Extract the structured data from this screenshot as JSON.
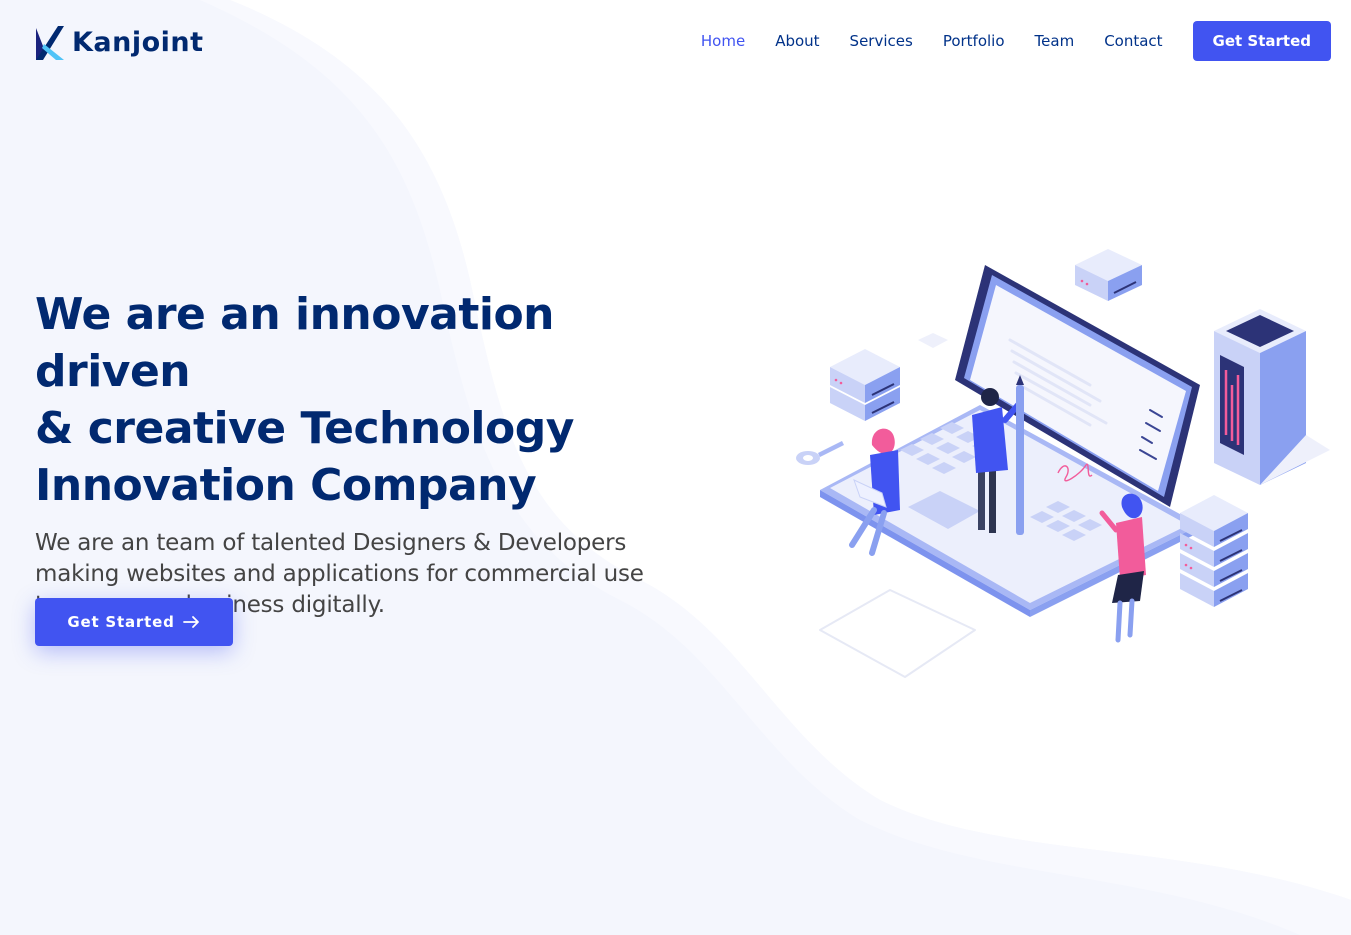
{
  "brand": {
    "name": "Kanjoint"
  },
  "nav": {
    "items": [
      {
        "label": "Home",
        "active": true
      },
      {
        "label": "About",
        "active": false
      },
      {
        "label": "Services",
        "active": false
      },
      {
        "label": "Portfolio",
        "active": false
      },
      {
        "label": "Team",
        "active": false
      },
      {
        "label": "Contact",
        "active": false
      }
    ],
    "cta_label": "Get Started"
  },
  "hero": {
    "title_lines": [
      "We are an innovation driven",
      "& creative Technology",
      "Innovation Company"
    ],
    "subtitle_lines": [
      "We are an team of talented Designers & Developers",
      "making websites and applications for commercial use",
      "to grow your business digitally."
    ],
    "button_label": "Get Started",
    "button_icon": "arrow-right-icon"
  },
  "colors": {
    "accent": "#4154f1",
    "heading": "#012970",
    "nav_text": "#013289",
    "body_text": "#444444",
    "background_wave": "#f4f6fd",
    "illustration_pink": "#f25c9b",
    "illustration_navy": "#2c3377"
  }
}
